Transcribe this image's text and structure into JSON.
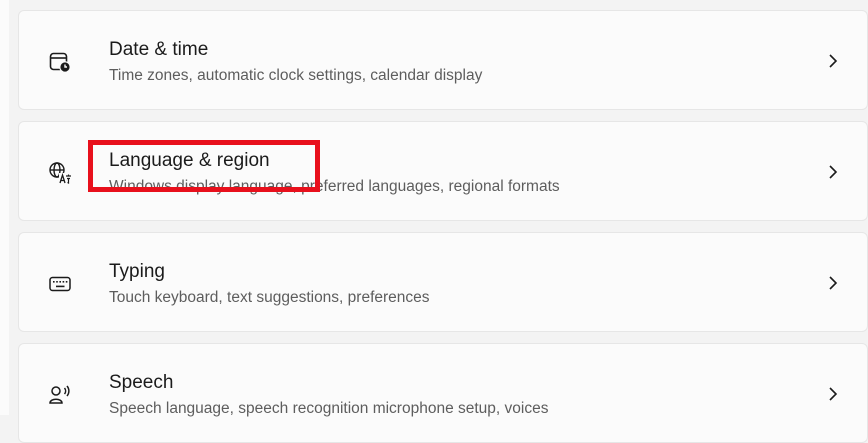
{
  "settings_items": [
    {
      "title": "Date & time",
      "description": "Time zones, automatic clock settings, calendar display",
      "icon": "calendar-clock-icon"
    },
    {
      "title": "Language & region",
      "description": "Windows display language, preferred languages, regional formats",
      "icon": "language-icon"
    },
    {
      "title": "Typing",
      "description": "Touch keyboard, text suggestions, preferences",
      "icon": "keyboard-icon"
    },
    {
      "title": "Speech",
      "description": "Speech language, speech recognition microphone setup, voices",
      "icon": "speech-icon"
    }
  ],
  "colors": {
    "background": "#f3f3f3",
    "card": "#fbfbfb",
    "highlight": "#e8101c"
  }
}
